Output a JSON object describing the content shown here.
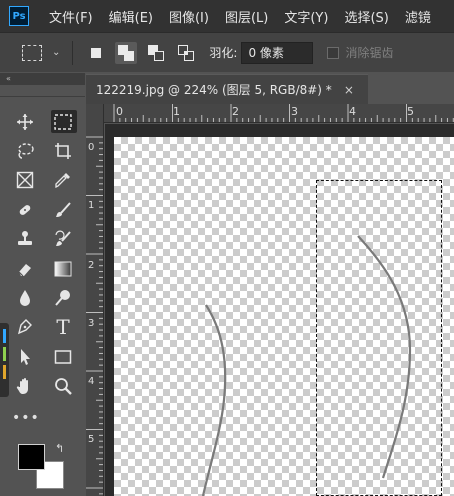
{
  "menubar": {
    "logo": "Ps",
    "items": [
      "文件(F)",
      "编辑(E)",
      "图像(I)",
      "图层(L)",
      "文字(Y)",
      "选择(S)",
      "滤镜"
    ]
  },
  "options": {
    "feather_label": "羽化:",
    "feather_value": "0 像素",
    "antialias_label": "消除锯齿"
  },
  "document": {
    "tab_title": "122219.jpg @ 224% (图层 5, RGB/8#) *",
    "close_glyph": "×",
    "ruler_h_labels": [
      "0",
      "1",
      "2",
      "3",
      "4",
      "5"
    ],
    "ruler_v_labels": [
      "0",
      "1",
      "2",
      "3",
      "4",
      "5"
    ]
  },
  "toolbar": {
    "collapse_glyph": "«",
    "more_glyph": "•••",
    "swap_glyph": "↰",
    "foreground_color": "#000000",
    "background_color": "#ffffff",
    "tools": [
      "move-tool-icon",
      "rect-marquee-tool-icon",
      "lasso-tool-icon",
      "crop-tool-icon",
      "frame-tool-icon",
      "eyedropper-tool-icon",
      "healing-brush-tool-icon",
      "brush-tool-icon",
      "clone-stamp-tool-icon",
      "history-brush-tool-icon",
      "eraser-tool-icon",
      "gradient-tool-icon",
      "blur-tool-icon",
      "dodge-tool-icon",
      "pen-tool-icon",
      "type-tool-icon",
      "path-selection-tool-icon",
      "rectangle-tool-icon",
      "hand-tool-icon",
      "zoom-tool-icon"
    ],
    "text_tool_glyph": "T"
  },
  "colors": {
    "accent": "#31a8ff",
    "menubar_bg": "#323232",
    "panel_bg": "#535353"
  }
}
